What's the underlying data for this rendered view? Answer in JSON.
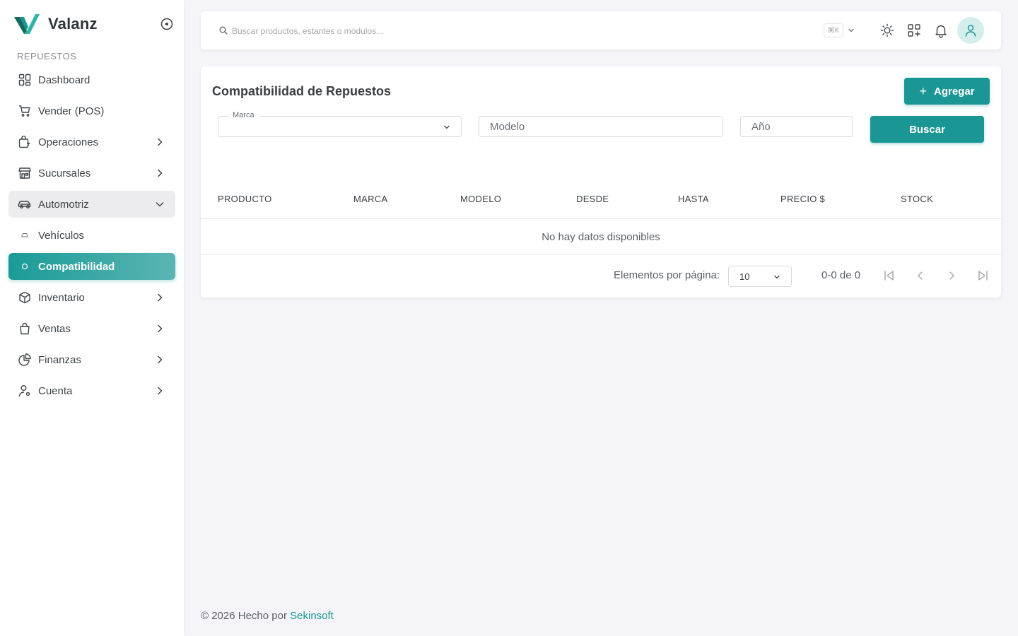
{
  "app": {
    "name": "Valanz"
  },
  "colors": {
    "accent": "#1a9694",
    "active_gradient_start": "#1a9b98",
    "active_gradient_end": "#5ab5b2"
  },
  "sidebar": {
    "section_label": "REPUESTOS",
    "items": [
      {
        "label": "Dashboard",
        "icon": "dashboard-icon"
      },
      {
        "label": "Vender (POS)",
        "icon": "cart-icon"
      },
      {
        "label": "Operaciones",
        "icon": "operations-icon"
      },
      {
        "label": "Sucursales",
        "icon": "store-icon"
      },
      {
        "label": "Automotriz",
        "icon": "car-icon"
      },
      {
        "label": "Vehículos",
        "icon": "circle-icon"
      },
      {
        "label": "Compatibilidad",
        "icon": "circle-icon"
      },
      {
        "label": "Inventario",
        "icon": "box-icon"
      },
      {
        "label": "Ventas",
        "icon": "bag-icon"
      },
      {
        "label": "Finanzas",
        "icon": "pie-chart-icon"
      },
      {
        "label": "Cuenta",
        "icon": "user-settings-icon"
      }
    ]
  },
  "topbar": {
    "search_placeholder": "Buscar productos, estantes o módulos...",
    "shortcut": "⌘K"
  },
  "main": {
    "title": "Compatibilidad de Repuestos",
    "add_label": "Agregar",
    "filters": {
      "marca_label": "Marca",
      "modelo_placeholder": "Modelo",
      "anio_placeholder": "Año",
      "search_label": "Buscar"
    },
    "table": {
      "columns": [
        "PRODUCTO",
        "MARCA",
        "MODELO",
        "DESDE",
        "HASTA",
        "PRECIO $",
        "STOCK"
      ],
      "empty_text": "No hay datos disponibles"
    },
    "pagination": {
      "per_page_label": "Elementos por página:",
      "per_page_value": "10",
      "range": "0-0 de 0"
    }
  },
  "footer": {
    "text": "© 2026 Hecho por",
    "link": "Sekinsoft"
  }
}
